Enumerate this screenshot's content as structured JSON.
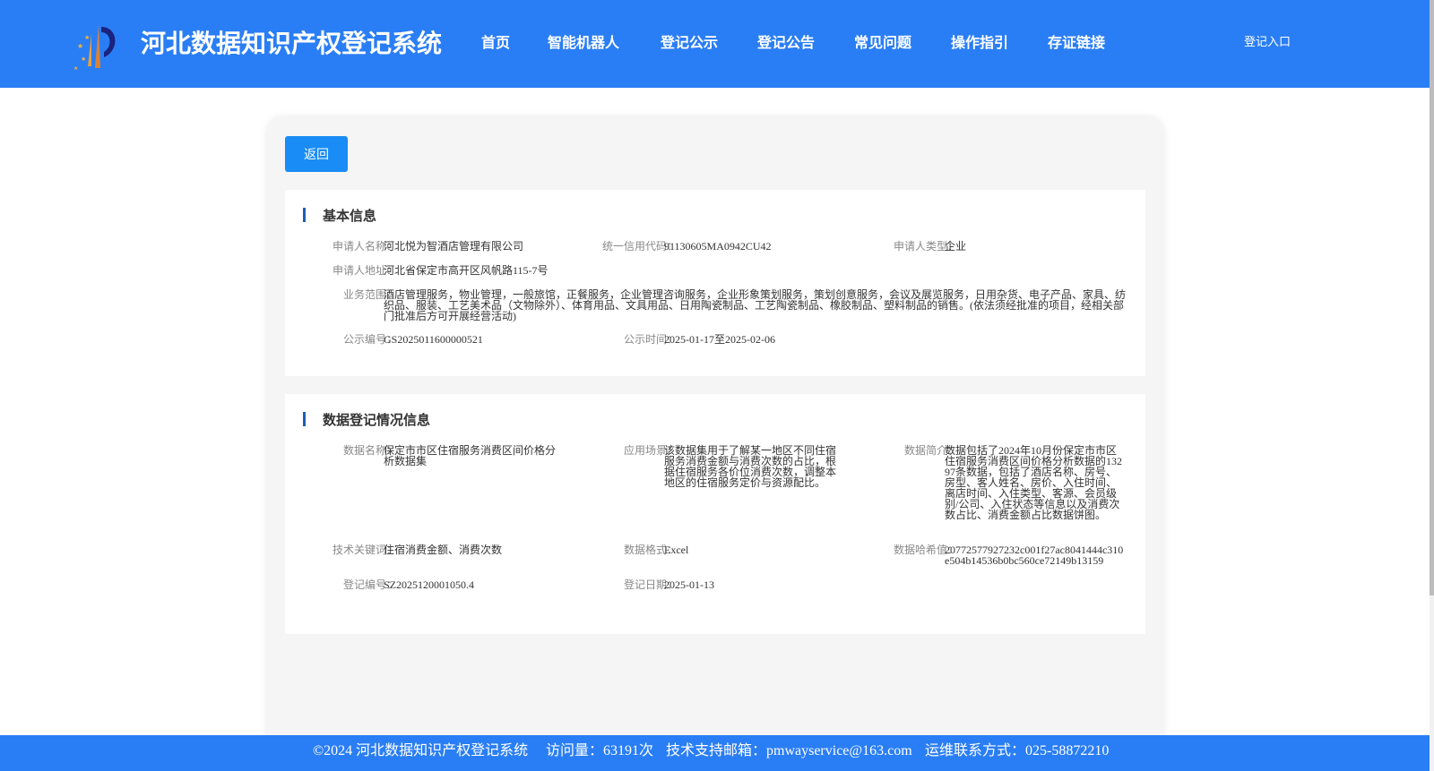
{
  "header": {
    "title": "河北数据知识产权登记系统",
    "nav": [
      "首页",
      "智能机器人",
      "登记公示",
      "登记公告",
      "常见问题",
      "操作指引",
      "存证链接"
    ],
    "login": "登记入口"
  },
  "back_label": "返回",
  "basic": {
    "title": "基本信息",
    "applicant_name_label": "申请人名称：",
    "applicant_name": "河北悦为智酒店管理有限公司",
    "credit_code_label": "统一信用代码：",
    "credit_code": "91130605MA0942CU42",
    "applicant_type_label": "申请人类型：",
    "applicant_type": "企业",
    "address_label": "申请人地址：",
    "address": "河北省保定市高开区风帆路115-7号",
    "scope_label": "业务范围：",
    "scope": "酒店管理服务，物业管理，一般旅馆，正餐服务，企业管理咨询服务，企业形象策划服务，策划创意服务，会议及展览服务，日用杂货、电子产品、家具、纺织品、服装、工艺美术品（文物除外）、体育用品、文具用品、日用陶瓷制品、工艺陶瓷制品、橡胶制品、塑料制品的销售。(依法须经批准的项目，经相关部门批准后方可开展经营活动)",
    "notice_no_label": "公示编号：",
    "notice_no": "GS2025011600000521",
    "notice_time_label": "公示时间：",
    "notice_time": "2025-01-17至2025-02-06"
  },
  "registration": {
    "title": "数据登记情况信息",
    "data_name_label": "数据名称：",
    "data_name": "保定市市区住宿服务消费区间价格分析数据集",
    "scenario_label": "应用场景：",
    "scenario": "该数据集用于了解某一地区不同住宿服务消费金额与消费次数的占比，根据住宿服务各价位消费次数，调整本地区的住宿服务定价与资源配比。",
    "summary_label": "数据简介：",
    "summary": "数据包括了2024年10月份保定市市区住宿服务消费区间价格分析数据的13297条数据，包括了酒店名称、房号、房型、客人姓名、房价、入住时间、离店时间、入住类型、客源、会员级别/公司、入住状态等信息以及消费次数占比、消费金额占比数据饼图。",
    "keywords_label": "技术关键词：",
    "keywords": "住宿消费金额、消费次数",
    "format_label": "数据格式：",
    "format": "Excel",
    "hash_label": "数据哈希值：",
    "hash": "20772577927232c001f27ac8041444c310e504b14536b0bc560ce72149b13159",
    "reg_no_label": "登记编号：",
    "reg_no": "SZ2025120001050.4",
    "reg_date_label": "登记日期：",
    "reg_date": "2025-01-13"
  },
  "footer": {
    "copyright": "©2024 河北数据知识产权登记系统",
    "visits": "访问量：63191次",
    "email": "技术支持邮箱：pmwayservice@163.com",
    "phone": "运维联系方式：025-58872210"
  },
  "colors": {
    "header_bg": "#2a7ef5",
    "button_bg": "#1a8cf5",
    "section_bar": "#1a5fb4"
  }
}
